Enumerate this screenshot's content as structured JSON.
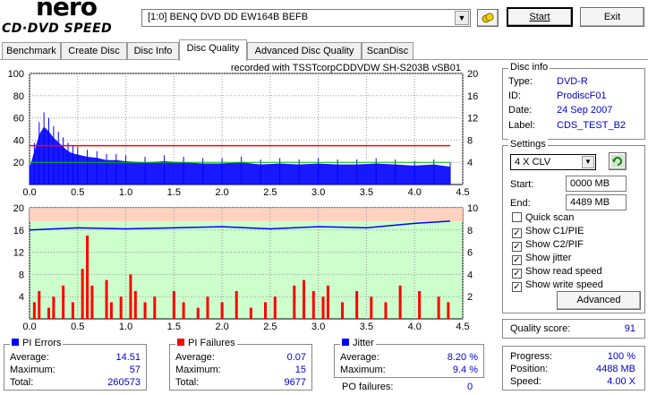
{
  "logo": {
    "main": "nero",
    "sub": "CD·DVD SPEED"
  },
  "drive_select": {
    "value": "[1:0]  BENQ DVD DD EW164B BEFB"
  },
  "buttons": {
    "start": "Start",
    "exit": "Exit",
    "advanced": "Advanced"
  },
  "icons": {
    "eject": "eject-icon",
    "refresh": "refresh-icon"
  },
  "tabs": [
    "Benchmark",
    "Create Disc",
    "Disc Info",
    "Disc Quality",
    "Advanced Disc Quality",
    "ScanDisc"
  ],
  "active_tab": "Disc Quality",
  "recorded_with": "recorded with TSSTcorpCDDVDW SH-S203B   vSB01",
  "disc_info": {
    "title": "Disc info",
    "rows": [
      {
        "label": "Type:",
        "value": "DVD-R"
      },
      {
        "label": "ID:",
        "value": "ProdiscF01"
      },
      {
        "label": "Date:",
        "value": "24 Sep 2007"
      },
      {
        "label": "Label:",
        "value": "CDS_TEST_B2"
      }
    ]
  },
  "settings": {
    "title": "Settings",
    "speed": "4 X CLV",
    "start_label": "Start:",
    "start_value": "0000 MB",
    "end_label": "End:",
    "end_value": "4489 MB",
    "checks": [
      {
        "label": "Quick scan",
        "checked": false
      },
      {
        "label": "Show C1/PIE",
        "checked": true
      },
      {
        "label": "Show C2/PIF",
        "checked": true
      },
      {
        "label": "Show jitter",
        "checked": true
      },
      {
        "label": "Show read speed",
        "checked": true
      },
      {
        "label": "Show write speed",
        "checked": true
      }
    ]
  },
  "quality": {
    "label": "Quality score:",
    "value": "91"
  },
  "progress": {
    "rows": [
      {
        "label": "Progress:",
        "value": "100 %"
      },
      {
        "label": "Position:",
        "value": "4488 MB"
      },
      {
        "label": "Speed:",
        "value": "4.00 X"
      }
    ]
  },
  "pi_errors": {
    "title": "PI Errors",
    "color": "#0000ff",
    "rows": [
      {
        "label": "Average:",
        "value": "14.51"
      },
      {
        "label": "Maximum:",
        "value": "57"
      },
      {
        "label": "Total:",
        "value": "260573"
      }
    ]
  },
  "pi_failures": {
    "title": "PI Failures",
    "color": "#ff0000",
    "rows": [
      {
        "label": "Average:",
        "value": "0.07"
      },
      {
        "label": "Maximum:",
        "value": "15"
      },
      {
        "label": "Total:",
        "value": "9677"
      }
    ]
  },
  "jitter": {
    "title": "Jitter",
    "color": "#0000ff",
    "rows": [
      {
        "label": "Average:",
        "value": "8.20 %"
      },
      {
        "label": "Maximum:",
        "value": "9.4 %"
      }
    ]
  },
  "po_failures": {
    "label": "PO failures:",
    "value": "0"
  },
  "chart_data": [
    {
      "type": "area",
      "name": "PI Errors (top chart)",
      "xlabel": "",
      "ylabel": "",
      "x_ticks": [
        "0.0",
        "0.5",
        "1.0",
        "1.5",
        "2.0",
        "2.5",
        "3.0",
        "3.5",
        "4.0",
        "4.5"
      ],
      "xlim": [
        0,
        4.5
      ],
      "ylim_left": [
        0,
        100
      ],
      "y_ticks_left": [
        "20",
        "40",
        "60",
        "80",
        "100"
      ],
      "ylim_right": [
        0,
        20
      ],
      "y_ticks_right": [
        "4",
        "8",
        "12",
        "16",
        "20"
      ],
      "grid": true,
      "series": [
        {
          "color": "#0000ff",
          "x": [
            0.0,
            0.05,
            0.1,
            0.15,
            0.2,
            0.25,
            0.3,
            0.35,
            0.4,
            0.45,
            0.5,
            0.6,
            0.7,
            0.8,
            0.9,
            1.0,
            1.2,
            1.4,
            1.6,
            1.8,
            2.0,
            2.2,
            2.4,
            2.6,
            2.8,
            3.0,
            3.2,
            3.4,
            3.6,
            3.8,
            4.0,
            4.2,
            4.37
          ],
          "values": [
            15,
            30,
            45,
            52,
            48,
            42,
            38,
            34,
            30,
            28,
            27,
            25,
            24,
            22,
            22,
            21,
            20,
            21,
            20,
            19,
            19,
            20,
            18,
            19,
            18,
            19,
            18,
            18,
            19,
            18,
            17,
            18,
            16
          ]
        },
        {
          "color": "#ff0000",
          "x": [
            0.0,
            0.5,
            1.0,
            1.5,
            2.0,
            2.5,
            3.0,
            3.5,
            4.0,
            4.37
          ],
          "values": [
            7,
            7,
            7,
            7,
            7,
            7,
            7,
            7,
            7,
            7
          ]
        }
      ]
    },
    {
      "type": "bar",
      "name": "PI Failures (bottom chart)",
      "xlabel": "",
      "ylabel": "",
      "x_ticks": [
        "0.0",
        "0.5",
        "1.0",
        "1.5",
        "2.0",
        "2.5",
        "3.0",
        "3.5",
        "4.0",
        "4.5"
      ],
      "xlim": [
        0,
        4.5
      ],
      "ylim_left": [
        0,
        20
      ],
      "y_ticks_left": [
        "4",
        "8",
        "12",
        "16",
        "20"
      ],
      "ylim_right": [
        0,
        10
      ],
      "y_ticks_right": [
        "2",
        "4",
        "6",
        "8",
        "10"
      ],
      "grid": true,
      "series": [
        {
          "color": "#ff0000",
          "x": [
            0.05,
            0.1,
            0.2,
            0.25,
            0.35,
            0.45,
            0.55,
            0.6,
            0.65,
            0.8,
            0.85,
            0.95,
            1.05,
            1.1,
            1.2,
            1.3,
            1.5,
            1.6,
            1.75,
            1.85,
            2.0,
            2.15,
            2.3,
            2.45,
            2.55,
            2.75,
            2.85,
            2.95,
            3.05,
            3.1,
            3.25,
            3.4,
            3.55,
            3.7,
            3.85,
            4.05,
            4.25,
            4.35
          ],
          "values": [
            3,
            5,
            2,
            4,
            6,
            3,
            9,
            15,
            6,
            7,
            3,
            4,
            8,
            5,
            3,
            4,
            5,
            3,
            2,
            4,
            3,
            5,
            2,
            3,
            4,
            6,
            7,
            5,
            4,
            6,
            3,
            5,
            4,
            3,
            6,
            5,
            4,
            3
          ]
        },
        {
          "color": "#0000ff",
          "x": [
            0.0,
            0.5,
            1.0,
            1.5,
            2.0,
            2.5,
            3.0,
            3.5,
            4.0,
            4.37
          ],
          "values": [
            8.0,
            8.2,
            8.1,
            8.2,
            8.3,
            8.1,
            8.3,
            8.2,
            8.6,
            8.8
          ]
        }
      ]
    }
  ]
}
